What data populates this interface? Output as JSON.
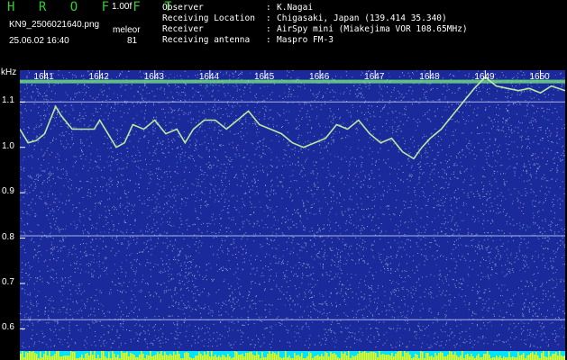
{
  "header": {
    "brand": "H R O F F T",
    "version": "1.00f",
    "filename": "KN9_2506021640.png",
    "timestamp": "25.06.02 16:40",
    "meteor_label": "meleor",
    "meteor_count": "81",
    "info": [
      {
        "key": "Observer",
        "value": "K.Nagai"
      },
      {
        "key": "Receiving Location",
        "value": "Chigasaki, Japan (139.414 35.340)"
      },
      {
        "key": "Receiver",
        "value": "AirSpy mini (Miakejima VOR 108.65MHz)"
      },
      {
        "key": "Receiving antenna",
        "value": "Maspro FM-3"
      }
    ]
  },
  "chart_data": {
    "type": "heatmap",
    "ylabel": "kHz",
    "y_ticks": [
      "1.1",
      "1.0",
      "0.9",
      "0.8",
      "0.7",
      "0.6"
    ],
    "y_tick_values": [
      1.1,
      1.0,
      0.9,
      0.8,
      0.7,
      0.6
    ],
    "ylim": [
      0.575,
      1.17
    ],
    "x_ticks": [
      "1641",
      "1642",
      "1643",
      "1644",
      "1645",
      "1646",
      "1647",
      "1648",
      "1649",
      "1650"
    ],
    "x_tick_values": [
      1641,
      1642,
      1643,
      1644,
      1645,
      1646,
      1647,
      1648,
      1649,
      1650
    ],
    "xlim": [
      1640.55,
      1650.45
    ],
    "colors": {
      "background": "#1a2a9a",
      "noise": "#ffffff",
      "trace": "#c8f0a0",
      "carrier": "#7af27a",
      "grid": "#cfd6ff",
      "activity": "#ffff00",
      "activity_base": "#00e5ff"
    },
    "carrier_khz": 1.145,
    "horizontal_lines_khz": [
      1.1,
      0.805,
      0.62
    ],
    "doppler_trace": [
      [
        1640.55,
        1.04
      ],
      [
        1640.7,
        1.01
      ],
      [
        1640.85,
        1.015
      ],
      [
        1641.0,
        1.03
      ],
      [
        1641.1,
        1.06
      ],
      [
        1641.2,
        1.09
      ],
      [
        1641.3,
        1.07
      ],
      [
        1641.5,
        1.04
      ],
      [
        1641.7,
        1.04
      ],
      [
        1641.9,
        1.04
      ],
      [
        1642.0,
        1.06
      ],
      [
        1642.15,
        1.03
      ],
      [
        1642.3,
        1.0
      ],
      [
        1642.45,
        1.01
      ],
      [
        1642.6,
        1.05
      ],
      [
        1642.8,
        1.04
      ],
      [
        1643.0,
        1.06
      ],
      [
        1643.2,
        1.03
      ],
      [
        1643.4,
        1.04
      ],
      [
        1643.55,
        1.01
      ],
      [
        1643.7,
        1.04
      ],
      [
        1643.9,
        1.06
      ],
      [
        1644.1,
        1.06
      ],
      [
        1644.3,
        1.04
      ],
      [
        1644.5,
        1.06
      ],
      [
        1644.7,
        1.08
      ],
      [
        1644.9,
        1.05
      ],
      [
        1645.1,
        1.04
      ],
      [
        1645.3,
        1.03
      ],
      [
        1645.5,
        1.01
      ],
      [
        1645.7,
        1.0
      ],
      [
        1645.9,
        1.01
      ],
      [
        1646.1,
        1.02
      ],
      [
        1646.3,
        1.05
      ],
      [
        1646.5,
        1.04
      ],
      [
        1646.7,
        1.06
      ],
      [
        1646.9,
        1.03
      ],
      [
        1647.1,
        1.01
      ],
      [
        1647.3,
        1.02
      ],
      [
        1647.5,
        0.99
      ],
      [
        1647.7,
        0.975
      ],
      [
        1647.85,
        1.0
      ],
      [
        1648.0,
        1.02
      ],
      [
        1648.2,
        1.04
      ],
      [
        1648.4,
        1.07
      ],
      [
        1648.6,
        1.1
      ],
      [
        1648.8,
        1.13
      ],
      [
        1649.0,
        1.155
      ],
      [
        1649.2,
        1.135
      ],
      [
        1649.4,
        1.13
      ],
      [
        1649.6,
        1.125
      ],
      [
        1649.8,
        1.13
      ],
      [
        1650.0,
        1.12
      ],
      [
        1650.2,
        1.135
      ],
      [
        1650.45,
        1.125
      ]
    ]
  }
}
